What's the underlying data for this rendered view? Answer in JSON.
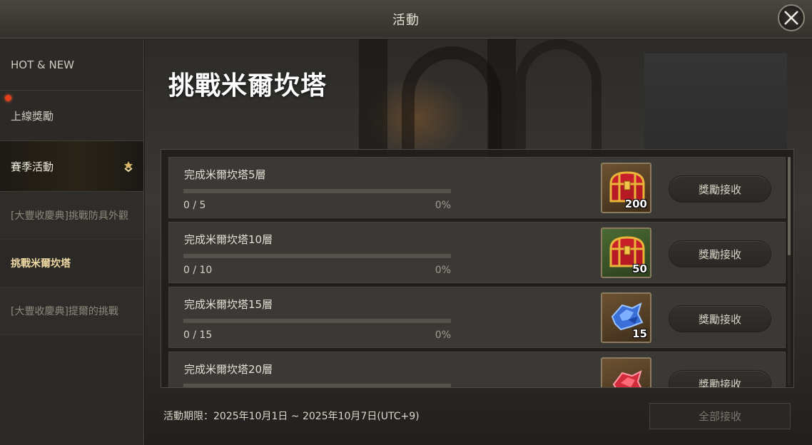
{
  "header": {
    "title": "活動"
  },
  "sidebar": {
    "items": [
      {
        "label": "HOT & NEW",
        "badge": false
      },
      {
        "label": "上線獎勵",
        "badge": true
      },
      {
        "label": "賽季活動",
        "expanded": true,
        "icon": "chevron-down-icon"
      }
    ],
    "sub_items": [
      {
        "label": "[大豐收慶典]挑戰防具外觀",
        "selected": false
      },
      {
        "label": "挑戰米爾坎塔",
        "selected": true
      },
      {
        "label": "[大豐收慶典]提爾的挑戰",
        "selected": false
      }
    ]
  },
  "main": {
    "title": "挑戰米爾坎塔",
    "missions": [
      {
        "name": "完成米爾坎塔5層",
        "count": "0 / 5",
        "percent_text": "0%",
        "progress": 0,
        "reward_icon": "red-treasure-chest-icon",
        "reward_qty": "200",
        "slot_color": "brown",
        "claim_label": "獎勵接收"
      },
      {
        "name": "完成米爾坎塔10層",
        "count": "0 / 10",
        "percent_text": "0%",
        "progress": 0,
        "reward_icon": "red-treasure-chest-icon",
        "reward_qty": "50",
        "slot_color": "green",
        "claim_label": "獎勵接收"
      },
      {
        "name": "完成米爾坎塔15層",
        "count": "0 / 15",
        "percent_text": "0%",
        "progress": 0,
        "reward_icon": "blue-crystal-icon",
        "reward_qty": "15",
        "slot_color": "brown",
        "claim_label": "獎勵接收"
      },
      {
        "name": "完成米爾坎塔20層",
        "count": "",
        "percent_text": "",
        "progress": 0,
        "reward_icon": "red-crystal-icon",
        "reward_qty": "",
        "slot_color": "brown",
        "claim_label": "獎勵接收"
      }
    ],
    "period": "活動期限：2025年10月1日 ~ 2025年10月7日(UTC+9)",
    "claim_all_label": "全部接收"
  },
  "colors": {
    "accent_gold": "#f0d9a4",
    "badge_red": "#e2401c",
    "progress_fill": "#c9a35c"
  }
}
